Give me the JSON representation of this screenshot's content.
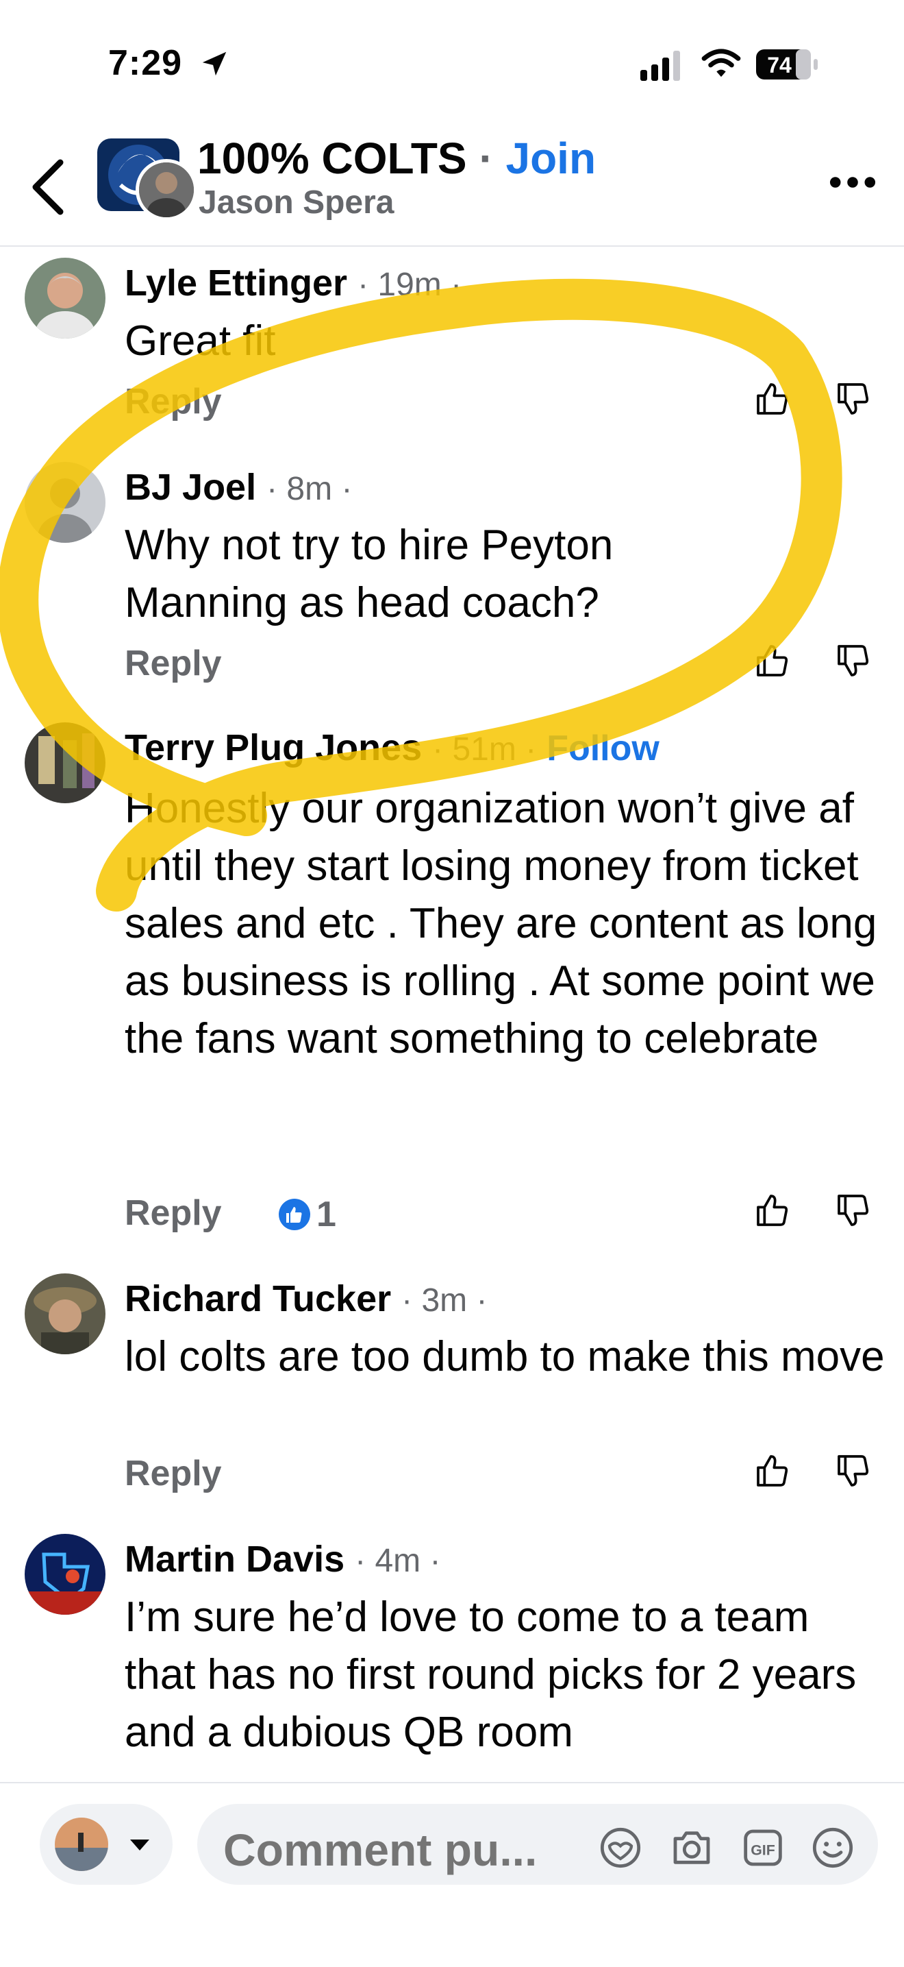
{
  "status_bar": {
    "time": "7:29",
    "battery": "74"
  },
  "header": {
    "group_name": "100% COLTS",
    "separator": "·",
    "join_label": "Join",
    "poster_name": "Jason Spera"
  },
  "comments": [
    {
      "name": "Lyle Ettinger",
      "meta": "· 19m ·",
      "body": "Great fit",
      "reply": "Reply"
    },
    {
      "name": "BJ Joel",
      "meta": "· 8m ·",
      "body": "Why not try to hire Peyton Manning as head coach?",
      "reply": "Reply"
    },
    {
      "name": "Terry Plug Jones",
      "meta": "· 51m ·",
      "follow": "Follow",
      "body": "Honestly our organization won’t give af until they start losing money from ticket sales and etc . They are content as long as business is rolling . At some point we the fans want something to celebrate",
      "reply": "Reply",
      "reaction_count": "1"
    },
    {
      "name": "Richard Tucker",
      "meta": "· 3m ·",
      "body": "lol colts are too dumb to make this move",
      "reply": "Reply"
    },
    {
      "name": "Martin Davis",
      "meta": "· 4m ·",
      "body": "I’m sure he’d love to come to a team that has no first round picks for 2 years and a dubious QB room",
      "reply": ""
    }
  ],
  "composer": {
    "placeholder": "Comment pu..."
  },
  "colors": {
    "accent": "#1b74e4",
    "highlight": "#f7c600",
    "secondary_text": "#65676b"
  },
  "icons": [
    "location-arrow-icon",
    "signal-icon",
    "wifi-icon",
    "battery-icon",
    "back-chevron-icon",
    "more-icon",
    "like-icon",
    "dislike-icon",
    "avatar-sticker-icon",
    "camera-icon",
    "gif-icon",
    "emoji-icon"
  ]
}
